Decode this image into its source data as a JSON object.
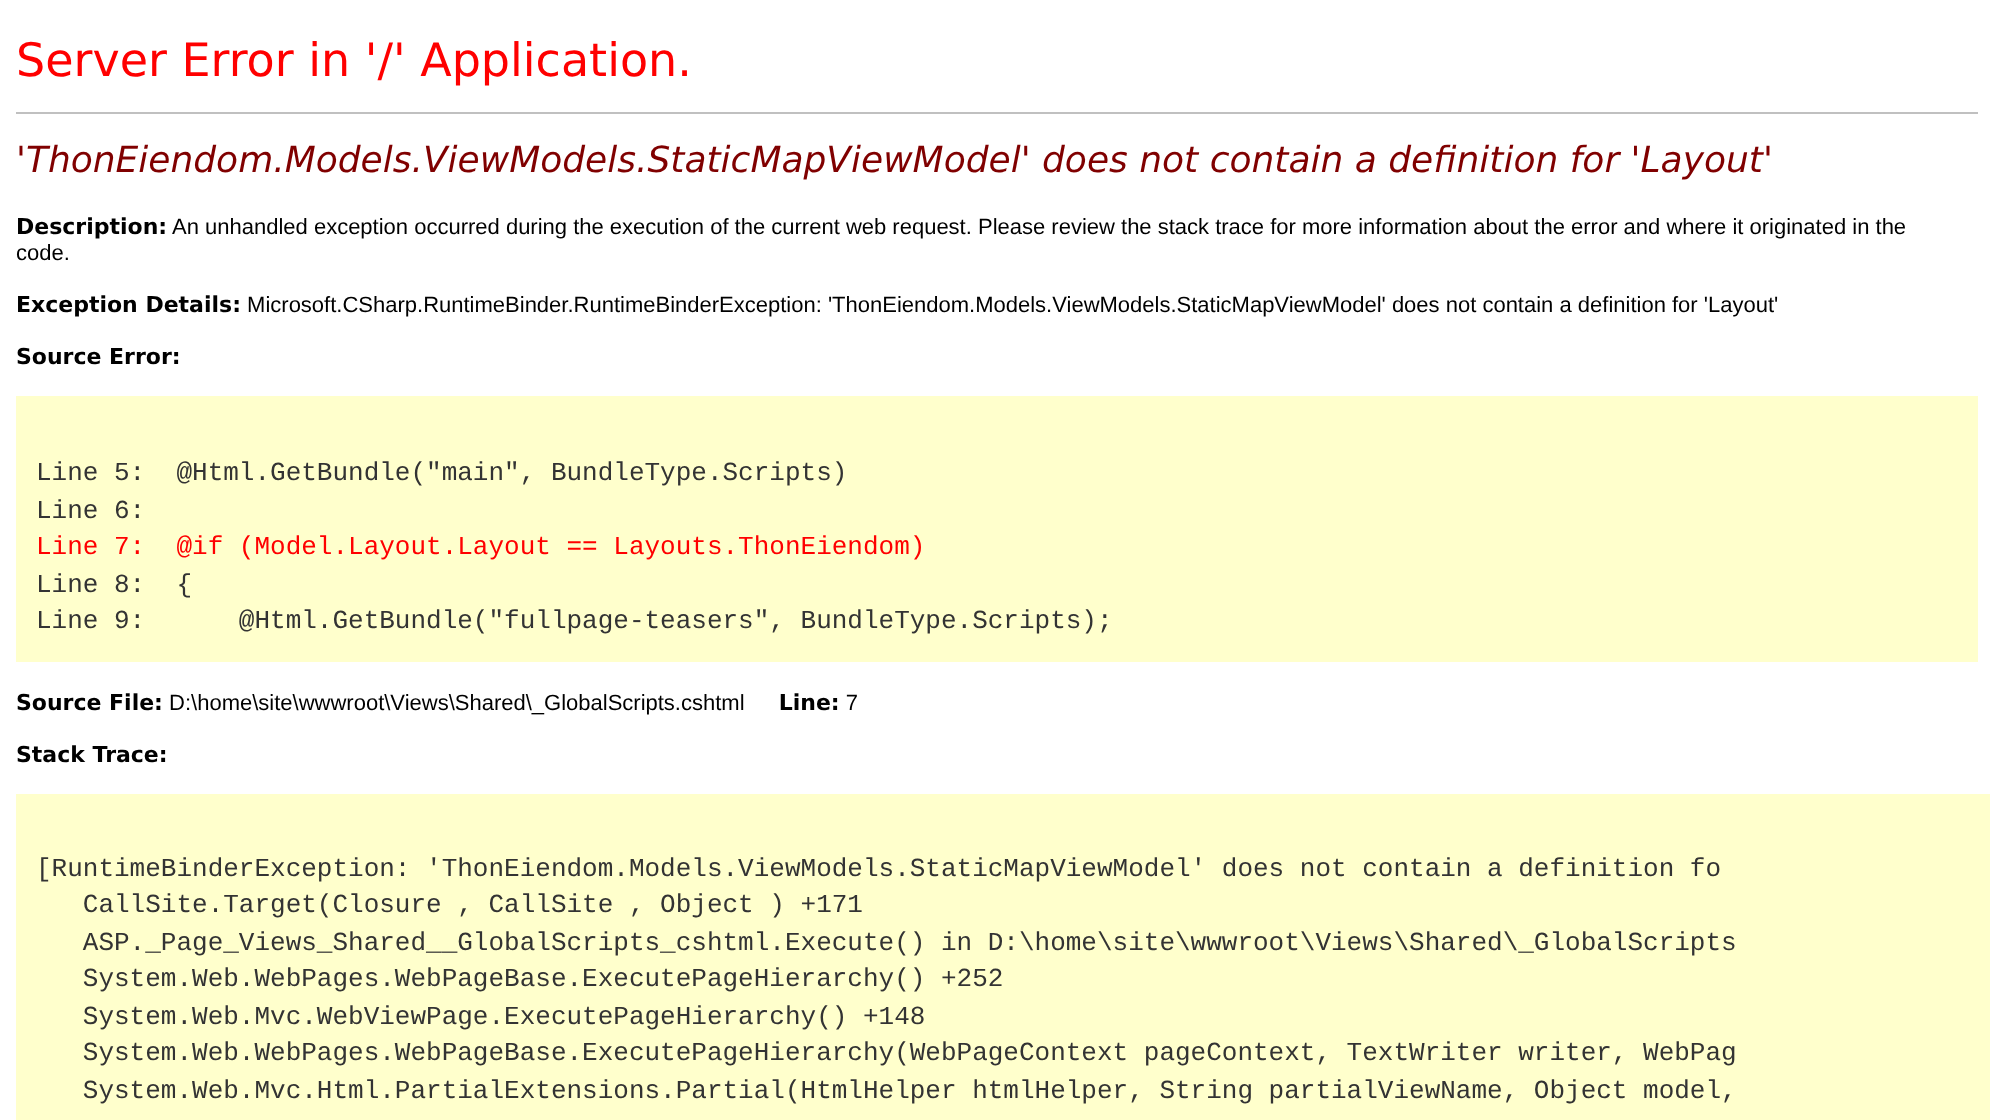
{
  "title": "Server Error in '/' Application.",
  "error_heading": "'ThonEiendom.Models.ViewModels.StaticMapViewModel' does not contain a definition for 'Layout'",
  "description": {
    "label": "Description:",
    "text": "An unhandled exception occurred during the execution of the current web request. Please review the stack trace for more information about the error and where it originated in the code."
  },
  "exception_details": {
    "label": "Exception Details:",
    "text": "Microsoft.CSharp.RuntimeBinder.RuntimeBinderException: 'ThonEiendom.Models.ViewModels.StaticMapViewModel' does not contain a definition for 'Layout'"
  },
  "source_error": {
    "label": "Source Error:",
    "lines": [
      {
        "text": "Line 5:  @Html.GetBundle(\"main\", BundleType.Scripts)",
        "highlighted": false
      },
      {
        "text": "Line 6:",
        "highlighted": false
      },
      {
        "text": "Line 7:  @if (Model.Layout.Layout == Layouts.ThonEiendom)",
        "highlighted": true
      },
      {
        "text": "Line 8:  {",
        "highlighted": false
      },
      {
        "text": "Line 9:      @Html.GetBundle(\"fullpage-teasers\", BundleType.Scripts);",
        "highlighted": false
      }
    ]
  },
  "source_file": {
    "label": "Source File:",
    "path": "D:\\home\\site\\wwwroot\\Views\\Shared\\_GlobalScripts.cshtml",
    "line_label": "Line:",
    "line": "7"
  },
  "stack_trace": {
    "label": "Stack Trace:",
    "lines": [
      "[RuntimeBinderException: 'ThonEiendom.Models.ViewModels.StaticMapViewModel' does not contain a definition fo",
      "   CallSite.Target(Closure , CallSite , Object ) +171",
      "   ASP._Page_Views_Shared__GlobalScripts_cshtml.Execute() in D:\\home\\site\\wwwroot\\Views\\Shared\\_GlobalScripts",
      "   System.Web.WebPages.WebPageBase.ExecutePageHierarchy() +252",
      "   System.Web.Mvc.WebViewPage.ExecutePageHierarchy() +148",
      "   System.Web.WebPages.WebPageBase.ExecutePageHierarchy(WebPageContext pageContext, TextWriter writer, WebPag",
      "   System.Web.Mvc.Html.PartialExtensions.Partial(HtmlHelper htmlHelper, String partialViewName, Object model,"
    ]
  }
}
